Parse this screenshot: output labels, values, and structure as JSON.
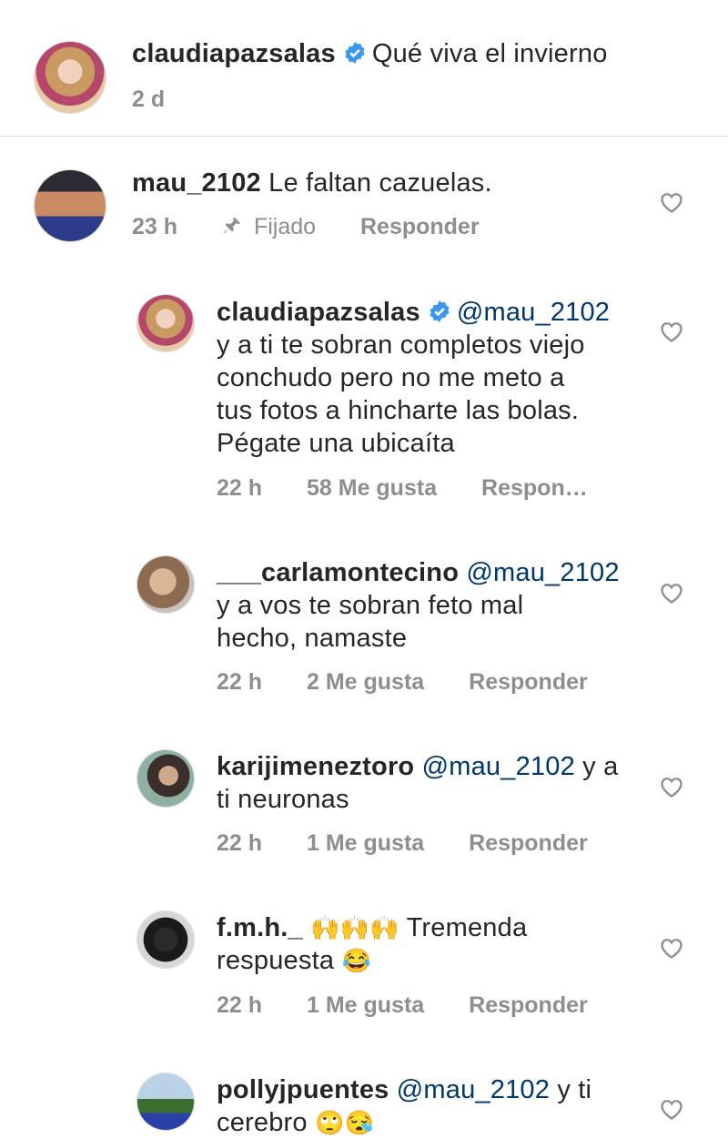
{
  "caption": {
    "username": "claudiapazsalas",
    "text": "Qué viva el invierno",
    "time": "2 d"
  },
  "comments": [
    {
      "username": "mau_2102",
      "text": "Le faltan cazuelas.",
      "time": "23 h",
      "pinned_label": "Fijado",
      "reply_label": "Responder"
    }
  ],
  "replies": [
    {
      "username": "claudiapazsalas",
      "mention": "@mau_2102",
      "text_line1": "y a ti te sobran completos viejo",
      "text_line2": "conchudo pero no me meto a",
      "text_line3": "tus fotos a hincharte las bolas.",
      "text_line4": "Pégate una ubicaíta",
      "time": "22 h",
      "likes": "58 Me gusta",
      "reply_label": "Respon…"
    },
    {
      "username": "___carlamontecino",
      "mention": "@mau_2102",
      "text_line1": "y a vos te sobran feto mal",
      "text_line2": "hecho, namaste",
      "time": "22 h",
      "likes": "2 Me gusta",
      "reply_label": "Responder"
    },
    {
      "username": "karijimeneztoro",
      "mention": "@mau_2102",
      "text_tail": "y a",
      "text_line2": "ti neuronas",
      "time": "22 h",
      "likes": "1 Me gusta",
      "reply_label": "Responder"
    },
    {
      "username": "f.m.h._",
      "emoji": "🙌🙌🙌",
      "text_tail": "Tremenda",
      "text_line2": "respuesta",
      "emoji2": "😂",
      "time": "22 h",
      "likes": "1 Me gusta",
      "reply_label": "Responder"
    },
    {
      "username": "pollyjpuentes",
      "mention": "@mau_2102",
      "text_tail": "y ti",
      "text_line2": "cerebro",
      "emoji2": "🙄😪"
    }
  ],
  "icons": {
    "verified": "verified-badge-icon",
    "heart": "heart-icon",
    "pin": "pin-icon"
  },
  "colors": {
    "verified": "#3897f0",
    "mention": "#00376b",
    "meta": "#8e8e8e"
  }
}
